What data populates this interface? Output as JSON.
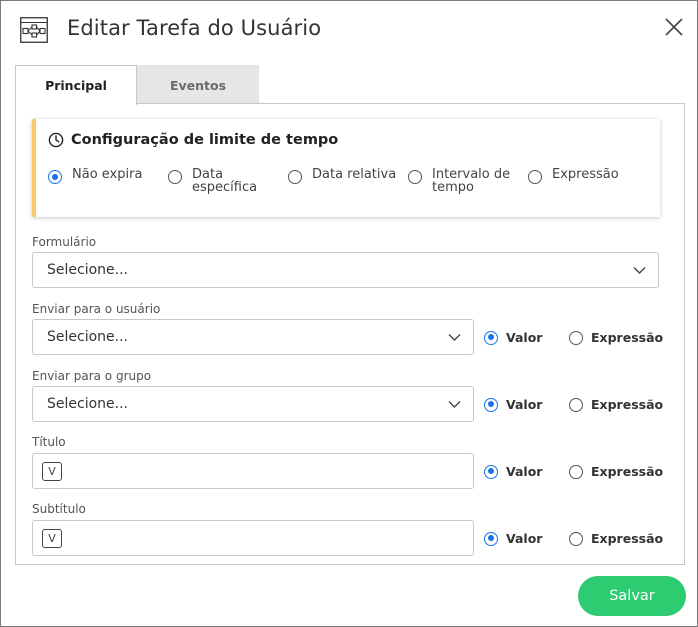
{
  "dialog": {
    "title": "Editar Tarefa do Usuário",
    "icon": "workflow-diagram-icon",
    "close_icon": "close-icon"
  },
  "tabs": [
    {
      "label": "Principal",
      "active": true
    },
    {
      "label": "Eventos",
      "active": false
    }
  ],
  "time_limit": {
    "title": "Configuração de limite de tempo",
    "icon": "clock-icon",
    "options": [
      {
        "line1": "Não expira",
        "line2": "",
        "selected": true
      },
      {
        "line1": "Data",
        "line2": "específica",
        "selected": false
      },
      {
        "line1": "Data relativa",
        "line2": "",
        "selected": false
      },
      {
        "line1": "Intervalo de",
        "line2": "tempo",
        "selected": false
      },
      {
        "line1": "Expressão",
        "line2": "",
        "selected": false
      }
    ]
  },
  "fields": {
    "formulario": {
      "label": "Formulário",
      "placeholder": "Selecione..."
    },
    "enviar_usuario": {
      "label": "Enviar para o usuário",
      "placeholder": "Selecione...",
      "mode_valor": "Valor",
      "mode_expressao": "Expressão",
      "selected_mode": "Valor"
    },
    "enviar_grupo": {
      "label": "Enviar para o grupo",
      "placeholder": "Selecione...",
      "mode_valor": "Valor",
      "mode_expressao": "Expressão",
      "selected_mode": "Valor"
    },
    "titulo": {
      "label": "Título",
      "badge": "V",
      "value": "",
      "mode_valor": "Valor",
      "mode_expressao": "Expressão",
      "selected_mode": "Valor"
    },
    "subtitulo": {
      "label": "Subtítulo",
      "badge": "V",
      "value": "",
      "mode_valor": "Valor",
      "mode_expressao": "Expressão",
      "selected_mode": "Valor"
    }
  },
  "footer": {
    "save_label": "Salvar"
  },
  "colors": {
    "accent_blue": "#1a73e8",
    "save_green": "#2ecc71",
    "timebox_border": "#f7c96a"
  }
}
